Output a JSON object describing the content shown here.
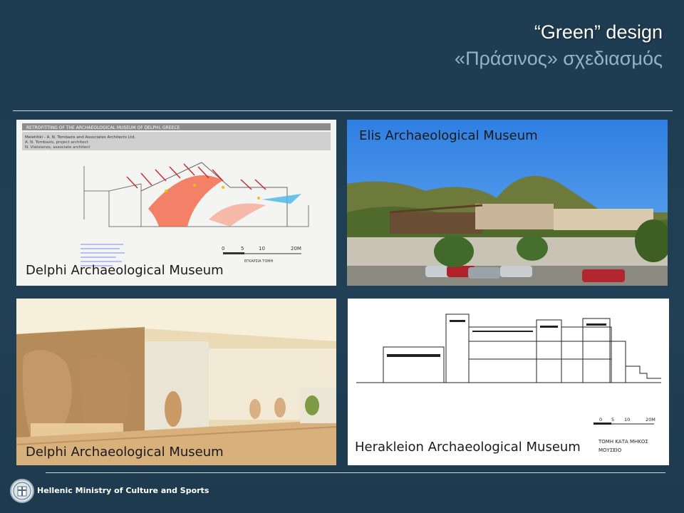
{
  "header": {
    "title": "“Green” design",
    "subtitle": "«Πράσινος» σχεδιασμός"
  },
  "panels": {
    "top_left": {
      "caption": "Delphi Archaeological Museum",
      "sheet_heading": "RETROFITTING OF THE ARCHAEOLOGICAL MUSEUM OF DELPHI, GREECE",
      "sheet_firm": "Meletitiki - A. N. Tombazis and Associates Architects Ltd.",
      "sheet_line1": "A. N. Tombazis, project architect",
      "sheet_line2": "N. Vlatsianos, associate architect",
      "scale_labels": [
        "0",
        "5",
        "10",
        "20M"
      ],
      "section_label": "ΕΓΚΑΡΣΙΑ ΤΟΜΗ"
    },
    "top_right": {
      "caption": "Elis Archaeological Museum"
    },
    "bottom_left": {
      "caption": "Delphi Archaeological Museum"
    },
    "bottom_right": {
      "caption": "Herakleion Archaeological Museum",
      "scale_labels": [
        "0",
        "5",
        "10",
        "20M"
      ],
      "section_label_1": "ΤΟΜΗ ΚΑΤΑ ΜΗΚΟΣ",
      "section_label_2": "ΜΟΥΣΕΙΟ"
    }
  },
  "footer": {
    "ministry": "Hellenic Ministry of Culture and Sports"
  }
}
